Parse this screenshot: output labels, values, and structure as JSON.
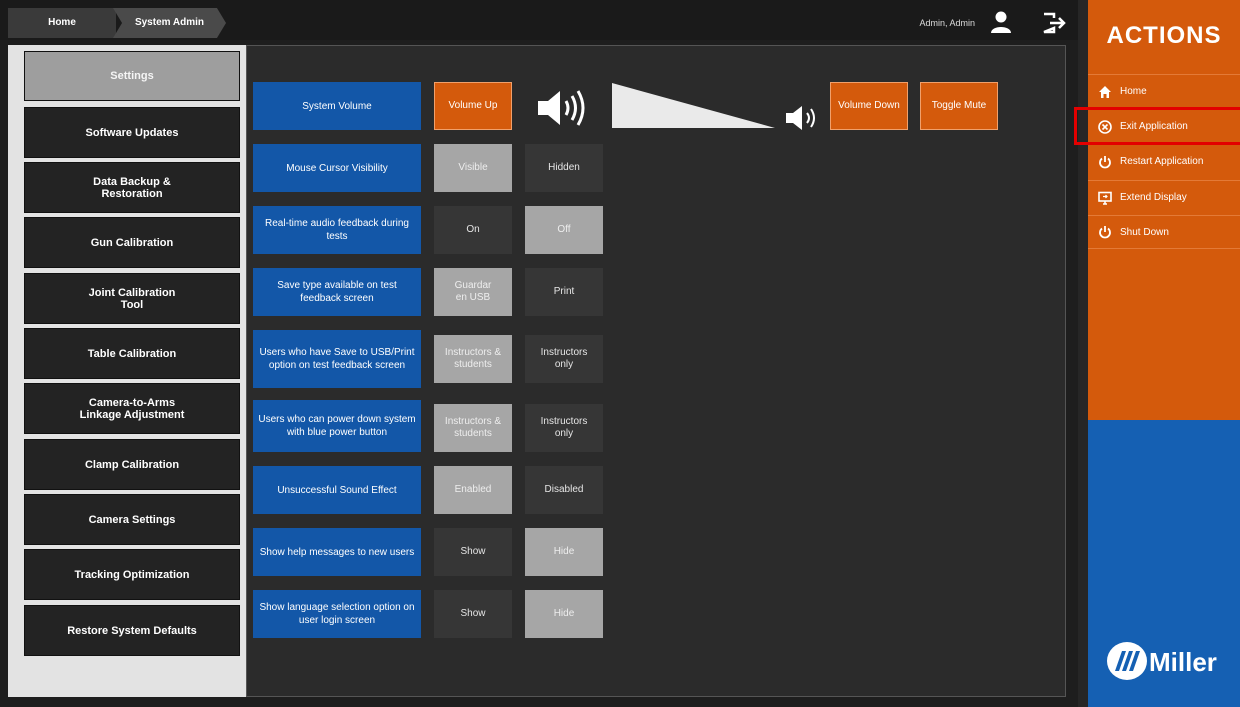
{
  "breadcrumb": {
    "home": "Home",
    "current": "System Admin"
  },
  "user": {
    "name": "Admin, Admin"
  },
  "nav": {
    "items": [
      {
        "label": "Settings",
        "active": true
      },
      {
        "label": "Software Updates"
      },
      {
        "label": "Data Backup & Restoration"
      },
      {
        "label": "Gun Calibration"
      },
      {
        "label": "Joint Calibration Tool"
      },
      {
        "label": "Table Calibration"
      },
      {
        "label": "Camera-to-Arms Linkage Adjustment"
      },
      {
        "label": "Clamp Calibration"
      },
      {
        "label": "Camera Settings"
      },
      {
        "label": "Tracking Optimization"
      },
      {
        "label": "Restore System Defaults"
      }
    ]
  },
  "settings": {
    "volume": {
      "label": "System Volume",
      "up": "Volume Up",
      "down": "Volume Down",
      "mute": "Toggle Mute"
    },
    "rows": [
      {
        "label": "Mouse Cursor Visibility",
        "opt1": "Visible",
        "opt2": "Hidden",
        "selected": 1
      },
      {
        "label": "Real-time audio feedback during tests",
        "opt1": "On",
        "opt2": "Off",
        "selected": 2
      },
      {
        "label": "Save type available on test feedback screen",
        "opt1": "Guardar en USB",
        "opt2": "Print",
        "selected": 1
      },
      {
        "label": "Users who have Save to USB/Print option on test feedback screen",
        "opt1": "Instructors & students",
        "opt2": "Instructors only",
        "selected": 1
      },
      {
        "label": "Users who can power down system with blue power button",
        "opt1": "Instructors & students",
        "opt2": "Instructors only",
        "selected": 1
      },
      {
        "label": "Unsuccessful Sound Effect",
        "opt1": "Enabled",
        "opt2": "Disabled",
        "selected": 1
      },
      {
        "label": "Show help messages to new users",
        "opt1": "Show",
        "opt2": "Hide",
        "selected": 2
      },
      {
        "label": "Show language selection option on user login screen",
        "opt1": "Show",
        "opt2": "Hide",
        "selected": 2
      }
    ]
  },
  "actions": {
    "title": "ACTIONS",
    "items": [
      {
        "label": "Home",
        "icon": "home-icon"
      },
      {
        "label": "Exit Application",
        "icon": "close-circle-icon"
      },
      {
        "label": "Restart Application",
        "icon": "power-icon"
      },
      {
        "label": "Extend Display",
        "icon": "display-icon"
      },
      {
        "label": "Shut Down",
        "icon": "power-icon"
      }
    ]
  },
  "brand": {
    "name": "Miller"
  },
  "colors": {
    "orange": "#d45a0c",
    "blue": "#1357a8",
    "brand_blue": "#1560b3",
    "highlight": "#e30000"
  }
}
